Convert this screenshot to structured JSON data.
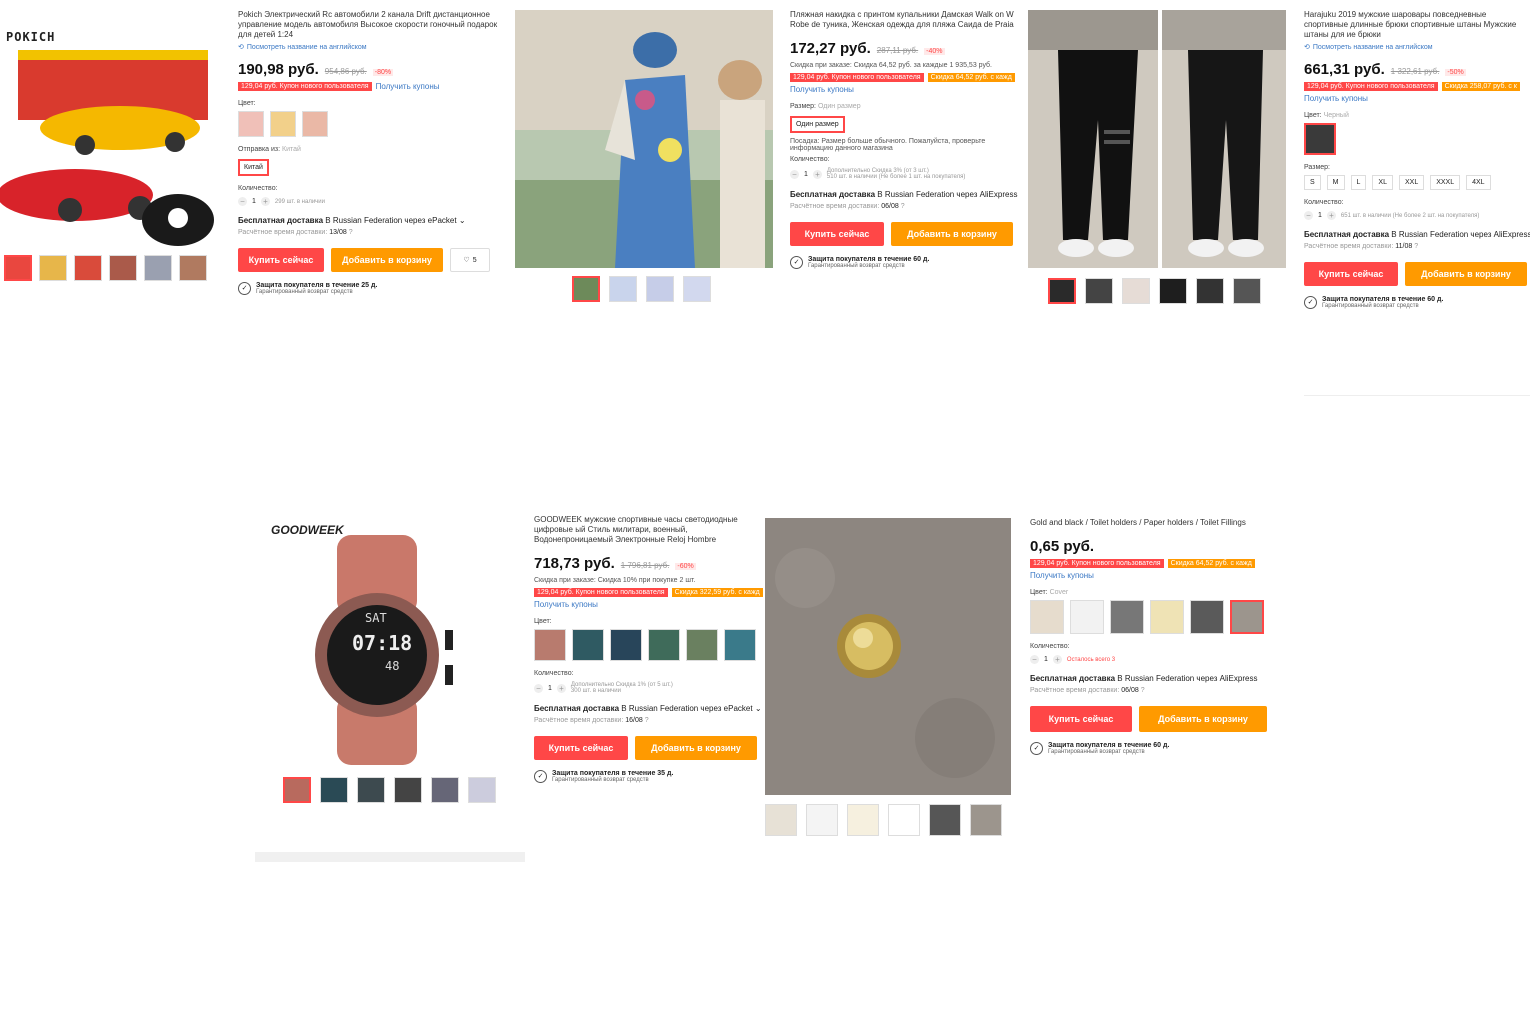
{
  "p1": {
    "brand": "POKICH",
    "title": "Pokich Электрический Rc автомобили 2 канала Drift дистанционное управление модель автомобиля Высокое скорости гоночный подарок для детей 1:24",
    "translate": "Посмотреть название на английском",
    "price": "190,98 руб.",
    "old_price": "954,86 руб.",
    "discount": "-80%",
    "coupon": "129,04 руб. Купон нового пользователя",
    "get_coupons": "Получить купоны",
    "color_label": "Цвет:",
    "ship_from_label": "Отправка из:",
    "ship_from_value": "Китай",
    "qty_label": "Количество:",
    "qty": "1",
    "qty_info": "299 шт. в наличии",
    "shipping_bold": "Бесплатная доставка",
    "shipping_rest": "В Russian Federation через ePacket",
    "eta_label": "Расчётное время доставки:",
    "eta_value": "13/08",
    "buy": "Купить сейчас",
    "cart": "Добавить в корзину",
    "wish_count": "5",
    "protect1": "Защита покупателя в течение 25 д.",
    "protect2": "Гарантированный возврат средств"
  },
  "p2": {
    "title": "Пляжная накидка с принтом купальники Дамская Walk on W Robe de туника, Женская одежда для пляжа Саида de Praia",
    "price": "172,27 руб.",
    "old_price": "287,11 руб.",
    "discount": "-40%",
    "bulk": "Скидка при заказе: Скидка 64,52 руб. за каждые 1 935,53 руб.",
    "coupon": "129,04 руб. Купон нового пользователя",
    "coupon2": "Скидка 64,52 руб. с кажд",
    "get_coupons": "Получить купоны",
    "size_label": "Размер:",
    "size_value": "Один размер",
    "fit": "Посадка: Размер больше обычного. Пожалуйста, проверьте информацию данного магазина",
    "qty_label": "Количество:",
    "qty": "1",
    "qty_info1": "Дополнительно Скидка 3% (от 3 шт.)",
    "qty_info2": "510 шт. в наличии (Не более 1 шт. на покупателя)",
    "shipping_bold": "Бесплатная доставка",
    "shipping_rest": "В Russian Federation через AliExpress",
    "eta_label": "Расчётное время доставки:",
    "eta_value": "06/08",
    "buy": "Купить сейчас",
    "cart": "Добавить в корзину",
    "protect1": "Защита покупателя в течение 60 д.",
    "protect2": "Гарантированный возврат средств"
  },
  "p3": {
    "title": "Harajuku 2019 мужские шаровары повседневные спортивные длинные брюки спортивные штаны Мужские штаны для ие брюки",
    "translate": "Посмотреть название на английском",
    "price": "661,31 руб.",
    "old_price": "1 322,61 руб.",
    "discount": "-50%",
    "coupon": "129,04 руб. Купон нового пользователя",
    "coupon2": "Скидка 258,07 руб. с к",
    "get_coupons": "Получить купоны",
    "color_label": "Цвет:",
    "color_value": "Черный",
    "size_label": "Размер:",
    "sizes": [
      "S",
      "M",
      "L",
      "XL",
      "XXL",
      "XXXL",
      "4XL"
    ],
    "qty_label": "Количество:",
    "qty": "1",
    "qty_info": "651 шт. в наличии (Не более 2 шт. на покупателя)",
    "shipping_bold": "Бесплатная доставка",
    "shipping_rest": "В Russian Federation через AliExpress",
    "eta_label": "Расчётное время доставки:",
    "eta_value": "11/08",
    "buy": "Купить сейчас",
    "cart": "Добавить в корзину",
    "protect1": "Защита покупателя в течение 60 д.",
    "protect2": "Гарантированный возврат средств"
  },
  "p4": {
    "brand": "GOODWEEK",
    "watch_time": "07:18",
    "watch_day": "SAT",
    "watch_sec": "48",
    "title": "GOODWEEK мужские спортивные часы светодиодные цифровые ый Стиль милитари, военный, Водонепроницаемый Электронные Reloj Hombre",
    "price": "718,73 руб.",
    "old_price": "1 796,81 руб.",
    "discount": "-60%",
    "bulk": "Скидка при заказе: Скидка 10% при покупке 2 шт.",
    "coupon": "129,04 руб. Купон нового пользователя",
    "coupon2": "Скидка 322,59 руб. с кажд",
    "get_coupons": "Получить купоны",
    "color_label": "Цвет:",
    "qty_label": "Количество:",
    "qty": "1",
    "qty_info1": "Дополнительно Скидка 1% (от 5 шт.)",
    "qty_info2": "300 шт. в наличии",
    "shipping_bold": "Бесплатная доставка",
    "shipping_rest": "В Russian Federation через ePacket",
    "eta_label": "Расчётное время доставки:",
    "eta_value": "16/08",
    "buy": "Купить сейчас",
    "cart": "Добавить в корзину",
    "protect1": "Защита покупателя в течение 35 д.",
    "protect2": "Гарантированный возврат средств"
  },
  "p5": {
    "title": "Gold and black / Toilet holders / Paper holders / Toilet Fillings",
    "price": "0,65 руб.",
    "coupon": "129,04 руб. Купон нового пользователя",
    "coupon2": "Скидка 64,52 руб. с кажд",
    "get_coupons": "Получить купоны",
    "color_label": "Цвет:",
    "color_value": "Cover",
    "qty_label": "Количество:",
    "qty": "1",
    "qty_info": "Осталось всего 3",
    "shipping_bold": "Бесплатная доставка",
    "shipping_rest": "В Russian Federation через AliExpress",
    "eta_label": "Расчётное время доставки:",
    "eta_value": "06/08",
    "buy": "Купить сейчас",
    "cart": "Добавить в корзину",
    "protect1": "Защита покупателя в течение 60 д.",
    "protect2": "Гарантированный возврат средств"
  },
  "colors": {
    "red": "#ff4747",
    "orange": "#ff9a00",
    "link": "#3b78c4"
  }
}
